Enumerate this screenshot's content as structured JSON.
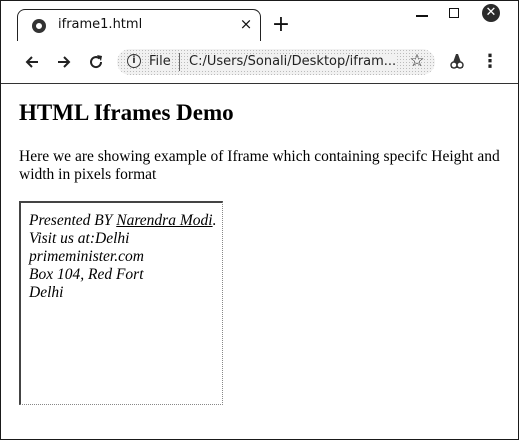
{
  "browser": {
    "tab_title": "iframe1.html",
    "tab_close": "×",
    "new_tab": "+",
    "window_close": "✕",
    "file_label": "File",
    "url": "C:/Users/Sonali/Desktop/ifram...",
    "icons": {
      "back": "arrow-left-icon",
      "forward": "arrow-right-icon",
      "reload": "reload-icon",
      "info": "info-icon",
      "bookmark": "star-icon",
      "extension": "extension-icon",
      "menu": "kebab-menu-icon"
    }
  },
  "page": {
    "heading": "HTML Iframes Demo",
    "description": "Here we are showing example of Iframe which containing specifc Height and width in pixels format",
    "iframe": {
      "presented_by_prefix": "Presented BY ",
      "presenter_link": "Narendra Modi",
      "presented_by_suffix": ".",
      "visit_line": "Visit us at:Delhi",
      "site": "primeminister.com",
      "address_line1": "Box 104, Red Fort",
      "address_line2": "Delhi"
    }
  }
}
